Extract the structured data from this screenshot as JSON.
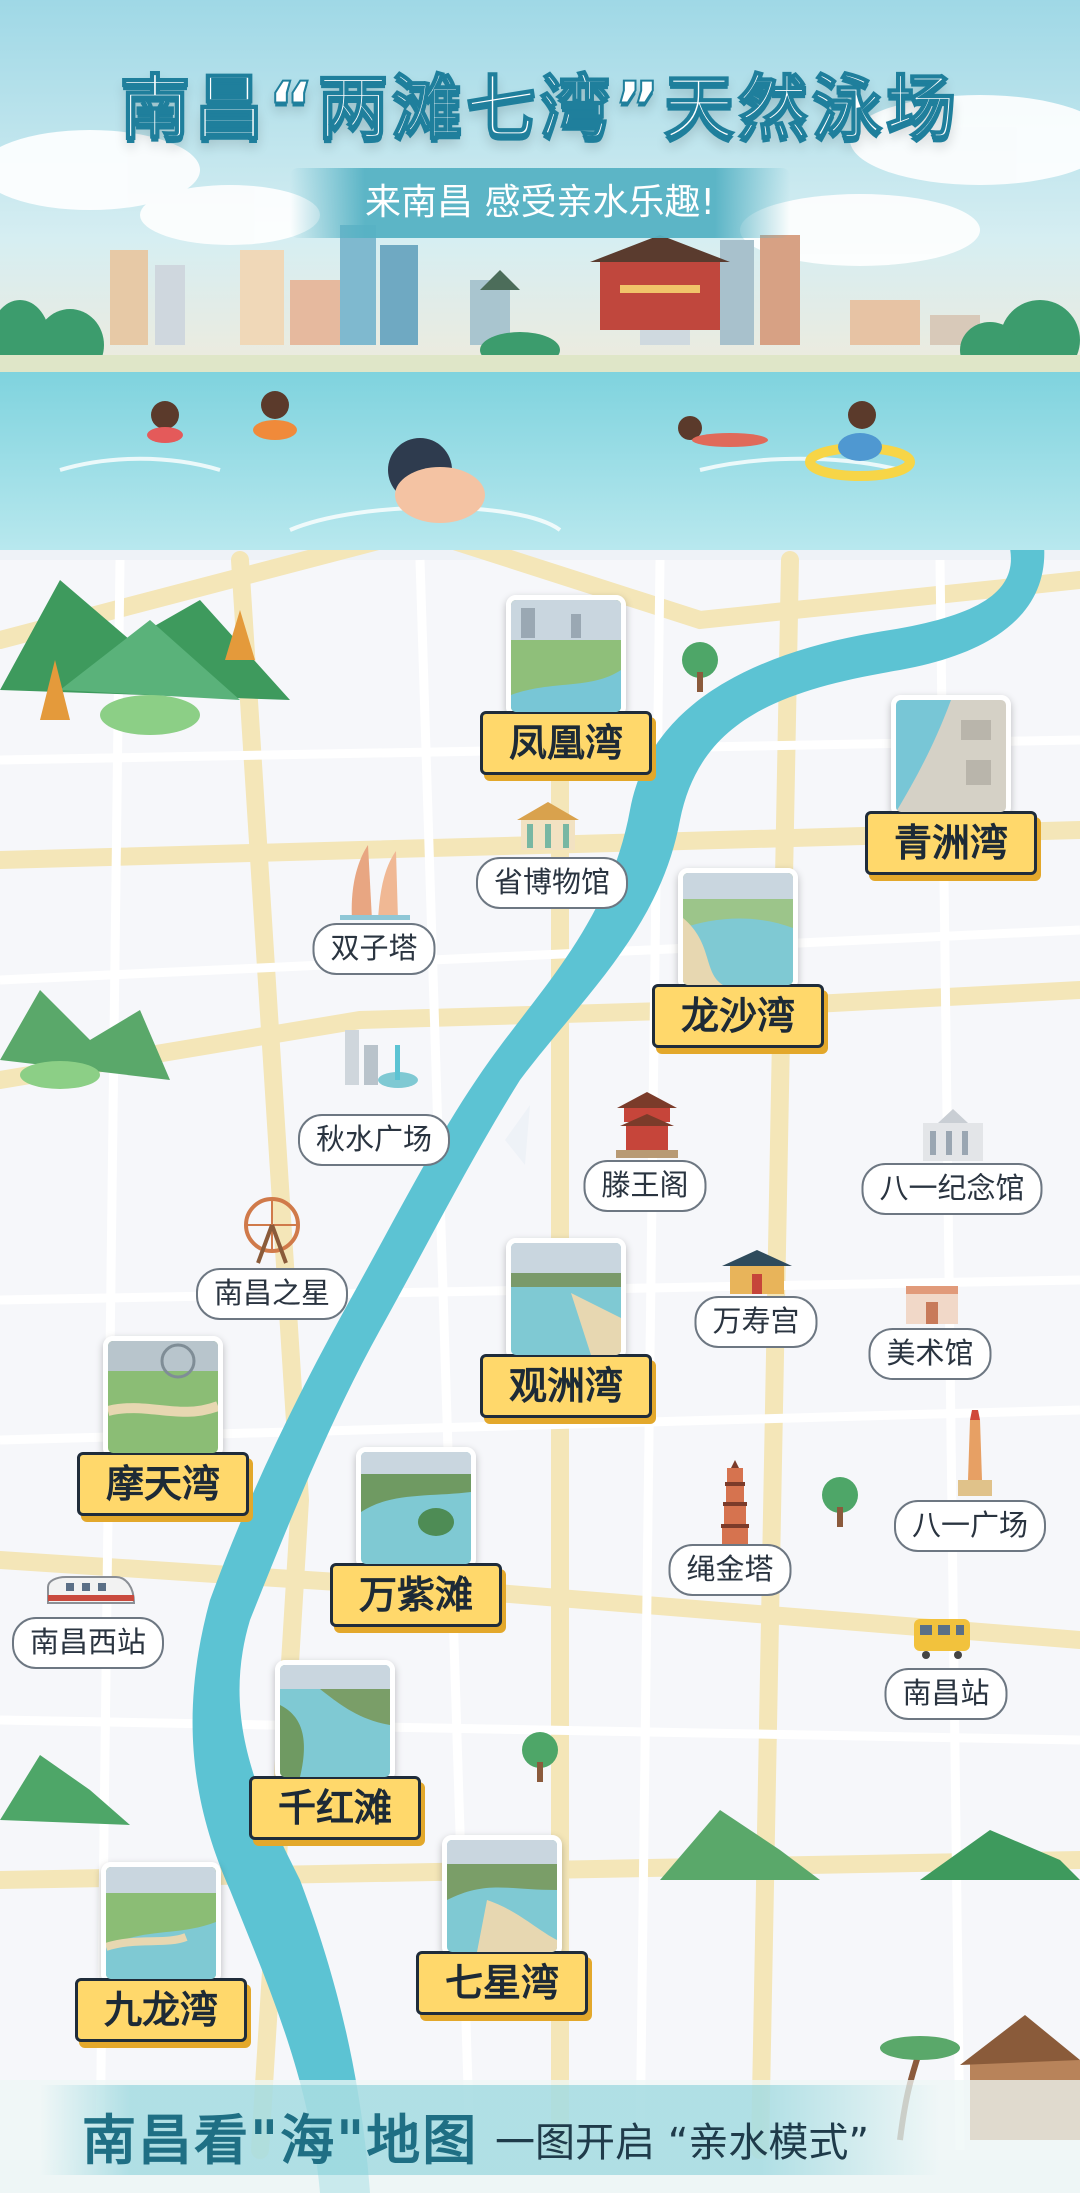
{
  "header": {
    "title": "南昌“两滩七湾”天然泳场",
    "subtitle": "来南昌 感受亲水乐趣!"
  },
  "bays": [
    {
      "id": "fenghuang",
      "label": "凤凰湾"
    },
    {
      "id": "qingzhou",
      "label": "青洲湾"
    },
    {
      "id": "longsha",
      "label": "龙沙湾"
    },
    {
      "id": "guanzhou",
      "label": "观洲湾"
    },
    {
      "id": "motian",
      "label": "摩天湾"
    },
    {
      "id": "wanzi",
      "label": "万紫滩"
    },
    {
      "id": "qianhong",
      "label": "千红滩"
    },
    {
      "id": "jiulong",
      "label": "九龙湾"
    },
    {
      "id": "qixing",
      "label": "七星湾"
    }
  ],
  "landmarks": [
    {
      "id": "museum",
      "label": "省博物馆",
      "icon": "museum-icon"
    },
    {
      "id": "twin-towers",
      "label": "双子塔",
      "icon": "twin-towers-icon"
    },
    {
      "id": "qiushui",
      "label": "秋水广场",
      "icon": "square-icon"
    },
    {
      "id": "tengwang",
      "label": "滕王阁",
      "icon": "pavilion-icon"
    },
    {
      "id": "bayi-memorial",
      "label": "八一纪念馆",
      "icon": "memorial-hall-icon"
    },
    {
      "id": "star",
      "label": "南昌之星",
      "icon": "ferris-wheel-icon"
    },
    {
      "id": "wanshou",
      "label": "万寿宫",
      "icon": "palace-icon"
    },
    {
      "id": "art",
      "label": "美术馆",
      "icon": "art-museum-icon"
    },
    {
      "id": "bayi-square",
      "label": "八一广场",
      "icon": "monument-icon"
    },
    {
      "id": "shengjin",
      "label": "绳金塔",
      "icon": "pagoda-icon"
    },
    {
      "id": "west-station",
      "label": "南昌西站",
      "icon": "high-speed-train-icon"
    },
    {
      "id": "station",
      "label": "南昌站",
      "icon": "train-icon"
    }
  ],
  "footer": {
    "main": "南昌看\"海\"地图",
    "sub": "一图开启 “亲水模式”"
  },
  "colors": {
    "river": "#5cc3d3",
    "sky": "#bfe6ee",
    "label_yellow": "#ffd86b",
    "title_outline": "#1f7f9c"
  }
}
